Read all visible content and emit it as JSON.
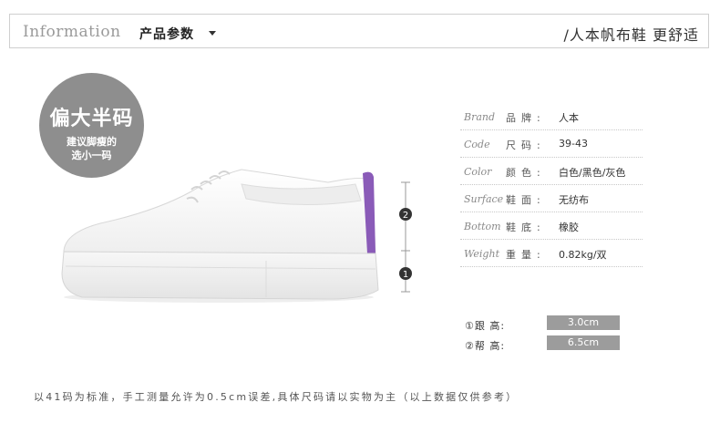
{
  "header": {
    "title_en": "Information",
    "title_cn": "产品参数",
    "brand_right": "/人本帆布鞋  更舒适"
  },
  "badge": {
    "main": "偏大半码",
    "sub_line1": "建议脚瘦的",
    "sub_line2": "选小一码"
  },
  "measure_markers": [
    "2",
    "1"
  ],
  "specs": [
    {
      "en": "Brand",
      "cn": "品牌:",
      "value": "人本"
    },
    {
      "en": "Code",
      "cn": "尺码:",
      "value": "39-43"
    },
    {
      "en": "Color",
      "cn": "颜色:",
      "value": "白色/黑色/灰色"
    },
    {
      "en": "Surface",
      "cn": "鞋面:",
      "value": "无纺布"
    },
    {
      "en": "Bottom",
      "cn": "鞋底:",
      "value": "橡胶"
    },
    {
      "en": "Weight",
      "cn": "重量:",
      "value": "0.82kg/双"
    }
  ],
  "heights": [
    {
      "label": "①跟  高:",
      "value": "3.0cm"
    },
    {
      "label": "②帮  高:",
      "value": "6.5cm"
    }
  ],
  "footer": "以41码为标准，手工测量允许为0.5cm误差,具体尺码请以实物为主（以上数据仅供参考）",
  "colors": {
    "badge": "#8e8e8e",
    "bar": "#9c9c9c",
    "accent_purple": "#8a5bb8"
  }
}
